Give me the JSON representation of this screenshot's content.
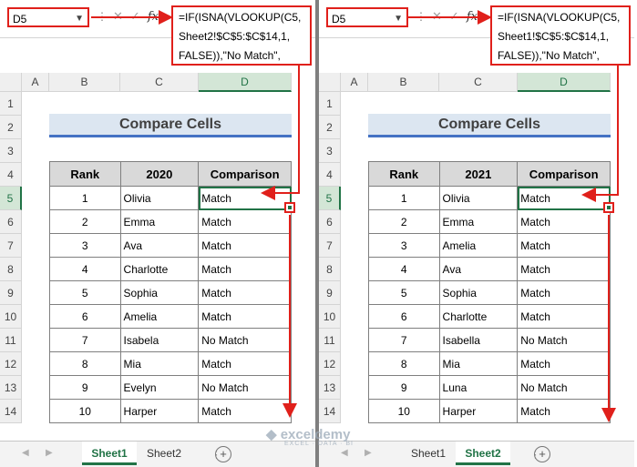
{
  "panes": [
    {
      "name_box": "D5",
      "formula_lines": [
        "=IF(ISNA(VLOOKUP(C5,",
        "Sheet2!$C$5:$C$14,1,",
        "FALSE)),\"No Match\","
      ],
      "title": "Compare Cells",
      "headers": [
        "Rank",
        "2020",
        "Comparison"
      ],
      "rows": [
        [
          "1",
          "Olivia",
          "Match"
        ],
        [
          "2",
          "Emma",
          "Match"
        ],
        [
          "3",
          "Ava",
          "Match"
        ],
        [
          "4",
          "Charlotte",
          "Match"
        ],
        [
          "5",
          "Sophia",
          "Match"
        ],
        [
          "6",
          "Amelia",
          "Match"
        ],
        [
          "7",
          "Isabela",
          "No Match"
        ],
        [
          "8",
          "Mia",
          "Match"
        ],
        [
          "9",
          "Evelyn",
          "No Match"
        ],
        [
          "10",
          "Harper",
          "Match"
        ]
      ],
      "tabs": [
        "Sheet1",
        "Sheet2"
      ],
      "active_tab": 0
    },
    {
      "name_box": "D5",
      "formula_lines": [
        "=IF(ISNA(VLOOKUP(C5,",
        "Sheet1!$C$5:$C$14,1,",
        "FALSE)),\"No Match\","
      ],
      "title": "Compare Cells",
      "headers": [
        "Rank",
        "2021",
        "Comparison"
      ],
      "rows": [
        [
          "1",
          "Olivia",
          "Match"
        ],
        [
          "2",
          "Emma",
          "Match"
        ],
        [
          "3",
          "Amelia",
          "Match"
        ],
        [
          "4",
          "Ava",
          "Match"
        ],
        [
          "5",
          "Sophia",
          "Match"
        ],
        [
          "6",
          "Charlotte",
          "Match"
        ],
        [
          "7",
          "Isabella",
          "No Match"
        ],
        [
          "8",
          "Mia",
          "Match"
        ],
        [
          "9",
          "Luna",
          "No Match"
        ],
        [
          "10",
          "Harper",
          "Match"
        ]
      ],
      "tabs": [
        "Sheet1",
        "Sheet2"
      ],
      "active_tab": 1
    }
  ],
  "column_headers": [
    "A",
    "B",
    "C",
    "D"
  ],
  "row_headers": [
    "1",
    "2",
    "3",
    "4",
    "5",
    "6",
    "7",
    "8",
    "9",
    "10",
    "11",
    "12",
    "13",
    "14"
  ],
  "selected_column": "D",
  "selected_row": "5",
  "icons": {
    "name_box_dropdown": "chevron-down-icon",
    "cancel": "cross-icon",
    "enter": "check-icon",
    "function": "fx-icon",
    "new_sheet": "plus-circle-icon"
  },
  "watermark": {
    "brand": "exceldemy",
    "tagline": "EXCEL · DATA · BI"
  },
  "colors": {
    "annotation": "#e0201b",
    "title_fill": "#dce6f1",
    "title_rule": "#4472c4",
    "header_fill": "#d9d9d9",
    "excel_green": "#217346"
  }
}
